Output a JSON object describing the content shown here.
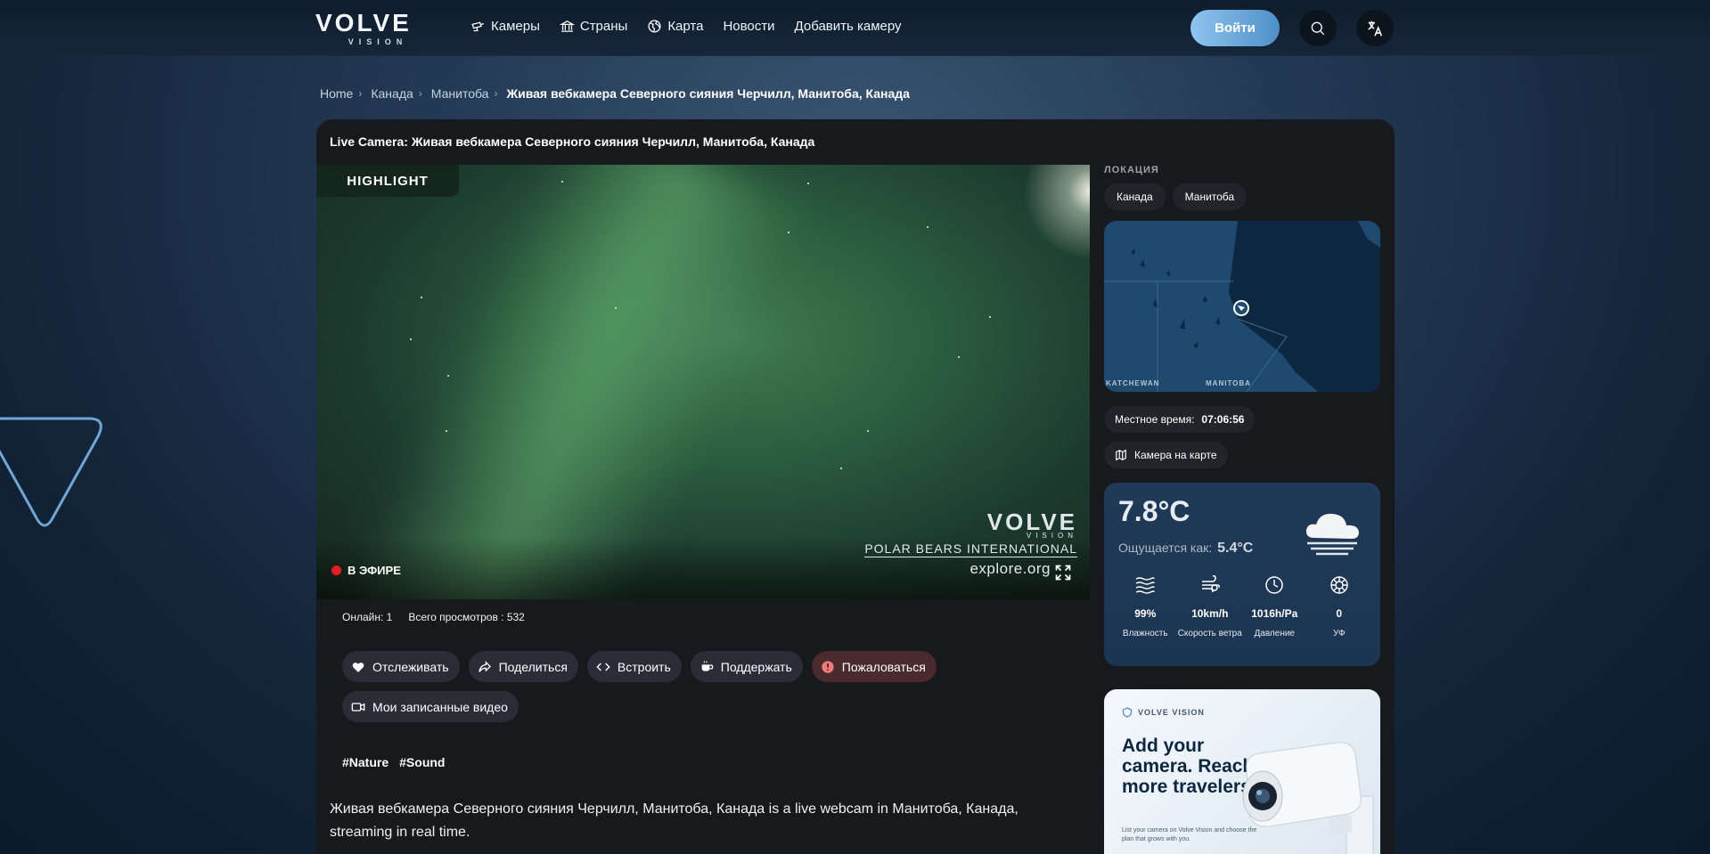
{
  "brand": {
    "logo": "VOLVE",
    "logo_sub": "VISION"
  },
  "nav": [
    {
      "label": "Камеры",
      "icon": "camera-icon"
    },
    {
      "label": "Страны",
      "icon": "landmark-icon"
    },
    {
      "label": "Карта",
      "icon": "globe-icon"
    },
    {
      "label": "Новости",
      "icon": ""
    },
    {
      "label": "Добавить камеру",
      "icon": ""
    }
  ],
  "header": {
    "login_label": "Войти",
    "search_icon": "search-icon",
    "language_icon": "translate-icon"
  },
  "breadcrumb": {
    "items": [
      "Home",
      "Канада",
      "Манитоба"
    ],
    "current": "Живая вебкамера Северного сияния Черчилл, Манитоба, Канада"
  },
  "main": {
    "title": "Live Camera: Живая вебкамера Северного сияния Черчилл, Манитоба, Канада",
    "video": {
      "highlight_tag": "HIGHLIGHT",
      "live_label": "В ЭФИРЕ",
      "watermark_logo": "VOLVE",
      "watermark_sub": "VISION",
      "watermark_pbi": "POLAR BEARS INTERNATIONAL",
      "watermark_explore": "explore.org"
    },
    "stats": {
      "online": "Онлайн: 1",
      "views": "Всего просмотров : 532"
    },
    "actions": [
      {
        "label": "Отслеживать",
        "icon": "heart-icon"
      },
      {
        "label": "Поделиться",
        "icon": "share-icon"
      },
      {
        "label": "Встроить",
        "icon": "code-icon"
      },
      {
        "label": "Поддержать",
        "icon": "coffee-icon"
      },
      {
        "label": "Пожаловаться",
        "icon": "alert-icon"
      },
      {
        "label": "Мои записанные видео",
        "icon": "video-icon"
      }
    ],
    "tags": [
      "#Nature",
      "#Sound"
    ],
    "description": "Живая вебкамера Северного сияния Черчилл, Манитоба, Канада is a live webcam in Манитоба, Канада, streaming in real time."
  },
  "sidebar": {
    "location_label": "ЛОКАЦИЯ",
    "location_chips": [
      "Канада",
      "Манитоба"
    ],
    "map_labels": [
      "KATCHEWAN",
      "MANITOBA"
    ],
    "local_time_label": "Местное время:",
    "local_time_value": "07:06:56",
    "map_link_label": "Камера на карте",
    "weather": {
      "temp": "7.8°C",
      "feels_label": "Ощущается как:",
      "feels_value": "5.4°C",
      "condition_icon": "fog-cloud-icon",
      "metrics": [
        {
          "value": "99%",
          "label": "Влажность",
          "icon": "humidity-icon"
        },
        {
          "value": "10km/h",
          "label": "Скорость ветра",
          "icon": "wind-icon"
        },
        {
          "value": "1016h/Pa",
          "label": "Давление",
          "icon": "pressure-icon"
        },
        {
          "value": "0",
          "label": "УФ",
          "icon": "uv-icon"
        }
      ]
    },
    "ad": {
      "brand": "VOLVE VISION",
      "headline": "Add your camera. Reach more travelers.",
      "small": "List your camera on Volve Vision and choose the plan that grows with you."
    }
  }
}
